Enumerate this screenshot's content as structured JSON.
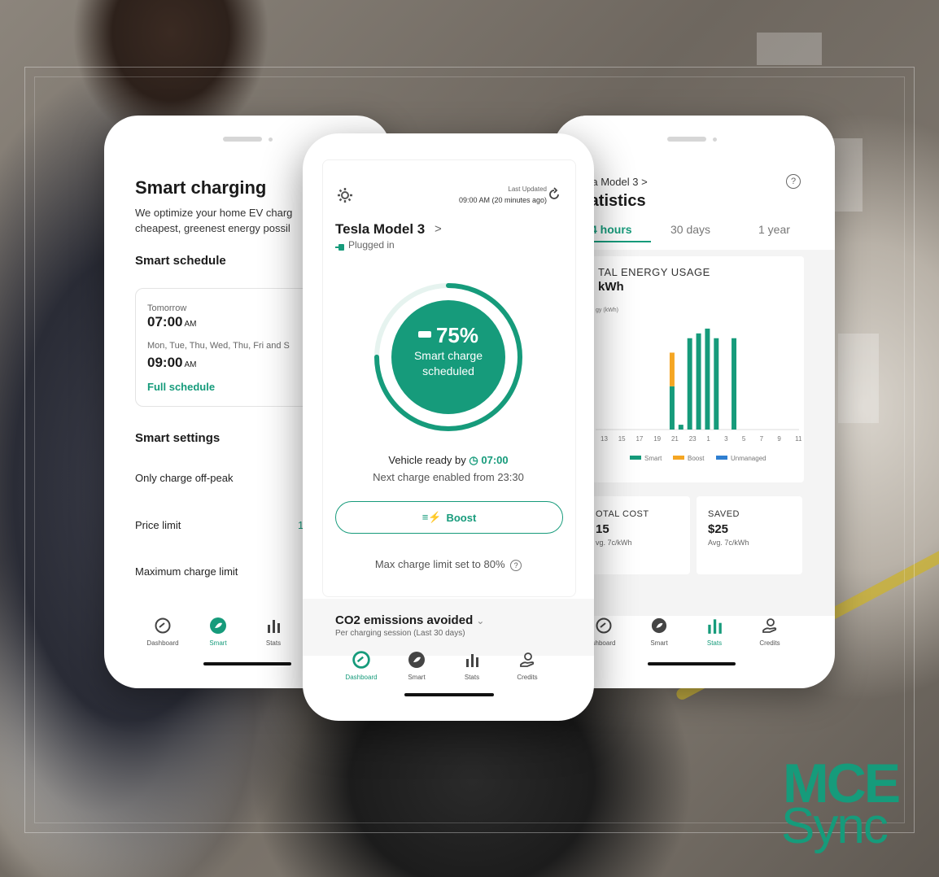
{
  "brand": {
    "logo_line1": "MCE",
    "logo_line2": "Sync",
    "accent_color": "#169b7b",
    "boost_color": "#f5a623",
    "unmanaged_color": "#2f7fd1"
  },
  "left_phone": {
    "title": "Smart charging",
    "description_line1": "We optimize your home EV charg",
    "description_line2": "cheapest, greenest energy possil",
    "smart_schedule_heading": "Smart schedule",
    "schedule": [
      {
        "day": "Tomorrow",
        "time": "07:00",
        "ampm": "AM"
      },
      {
        "day": "Mon, Tue, Thu, Wed, Thu, Fri and S",
        "time": "09:00",
        "ampm": "AM"
      }
    ],
    "full_schedule_link": "Full schedule",
    "smart_settings_heading": "Smart settings",
    "settings": [
      {
        "label": "Only charge off-peak",
        "value": ""
      },
      {
        "label": "Price limit",
        "value": "1"
      },
      {
        "label": "Maximum charge limit",
        "value": ""
      }
    ],
    "nav": [
      "Dashboard",
      "Smart",
      "Stats"
    ],
    "active_nav": "Smart"
  },
  "center_phone": {
    "last_updated_label": "Last Updated",
    "last_updated_time": "09:00 AM (20 minutes ago)",
    "vehicle": "Tesla Model 3",
    "vehicle_chevron": ">",
    "status": "Plugged in",
    "charge_percent": "75%",
    "charge_status_line1": "Smart charge",
    "charge_status_line2": "scheduled",
    "charge_fraction": 0.75,
    "ready_label": "Vehicle ready by",
    "ready_time": "07:00",
    "next_charge": "Next charge enabled from 23:30",
    "boost_label": "Boost",
    "max_charge": "Max charge limit set to 80%",
    "co2_title": "CO2 emissions avoided",
    "co2_subtitle": "Per charging session (Last 30 days)",
    "nav": [
      "Dashboard",
      "Smart",
      "Stats",
      "Credits"
    ],
    "active_nav": "Dashboard"
  },
  "right_phone": {
    "breadcrumb": "sla Model 3 >",
    "title": "tatistics",
    "tabs": [
      "4 hours",
      "30 days",
      "1 year"
    ],
    "active_tab": "4 hours",
    "usage_heading": "TAL ENERGY USAGE",
    "usage_value": "kWh",
    "axis_label": "gy (kWh)",
    "legend": [
      "Smart",
      "Boost",
      "Unmanaged"
    ],
    "cost_cards": [
      {
        "heading": "OTAL COST",
        "value": "15",
        "sub": "vg. 7c/kWh"
      },
      {
        "heading": "SAVED",
        "value": "$25",
        "sub": "Avg. 7c/kWh"
      }
    ],
    "nav": [
      "shboard",
      "Smart",
      "Stats",
      "Credits"
    ],
    "active_nav": "Stats"
  },
  "chart_data": {
    "type": "bar",
    "title": "",
    "xlabel": "",
    "ylabel": "gy (kWh)",
    "categories": [
      "13",
      "14",
      "15",
      "16",
      "17",
      "18",
      "19",
      "20",
      "21",
      "22",
      "23",
      "0",
      "1",
      "2",
      "3",
      "4",
      "5",
      "6",
      "7",
      "8",
      "9",
      "10",
      "11"
    ],
    "x_tick_labels": [
      "13",
      "15",
      "17",
      "19",
      "21",
      "23",
      "1",
      "3",
      "5",
      "7",
      "9",
      "11"
    ],
    "series": [
      {
        "name": "Smart",
        "values": [
          0,
          0,
          0,
          0,
          0,
          0,
          0,
          0,
          0.45,
          0.05,
          0.95,
          1.0,
          1.05,
          0.95,
          0,
          0.95,
          0,
          0,
          0,
          0,
          0,
          0,
          0
        ]
      },
      {
        "name": "Boost",
        "values": [
          0,
          0,
          0,
          0,
          0,
          0,
          0,
          0,
          0.35,
          0,
          0,
          0,
          0,
          0,
          0,
          0,
          0,
          0,
          0,
          0,
          0,
          0,
          0
        ]
      },
      {
        "name": "Unmanaged",
        "values": [
          0,
          0,
          0,
          0,
          0,
          0,
          0,
          0,
          0,
          0,
          0,
          0,
          0,
          0,
          0,
          0,
          0,
          0,
          0,
          0,
          0,
          0,
          0
        ]
      }
    ],
    "ylim": [
      0,
      1.1
    ],
    "grid": false,
    "legend_position": "bottom"
  }
}
